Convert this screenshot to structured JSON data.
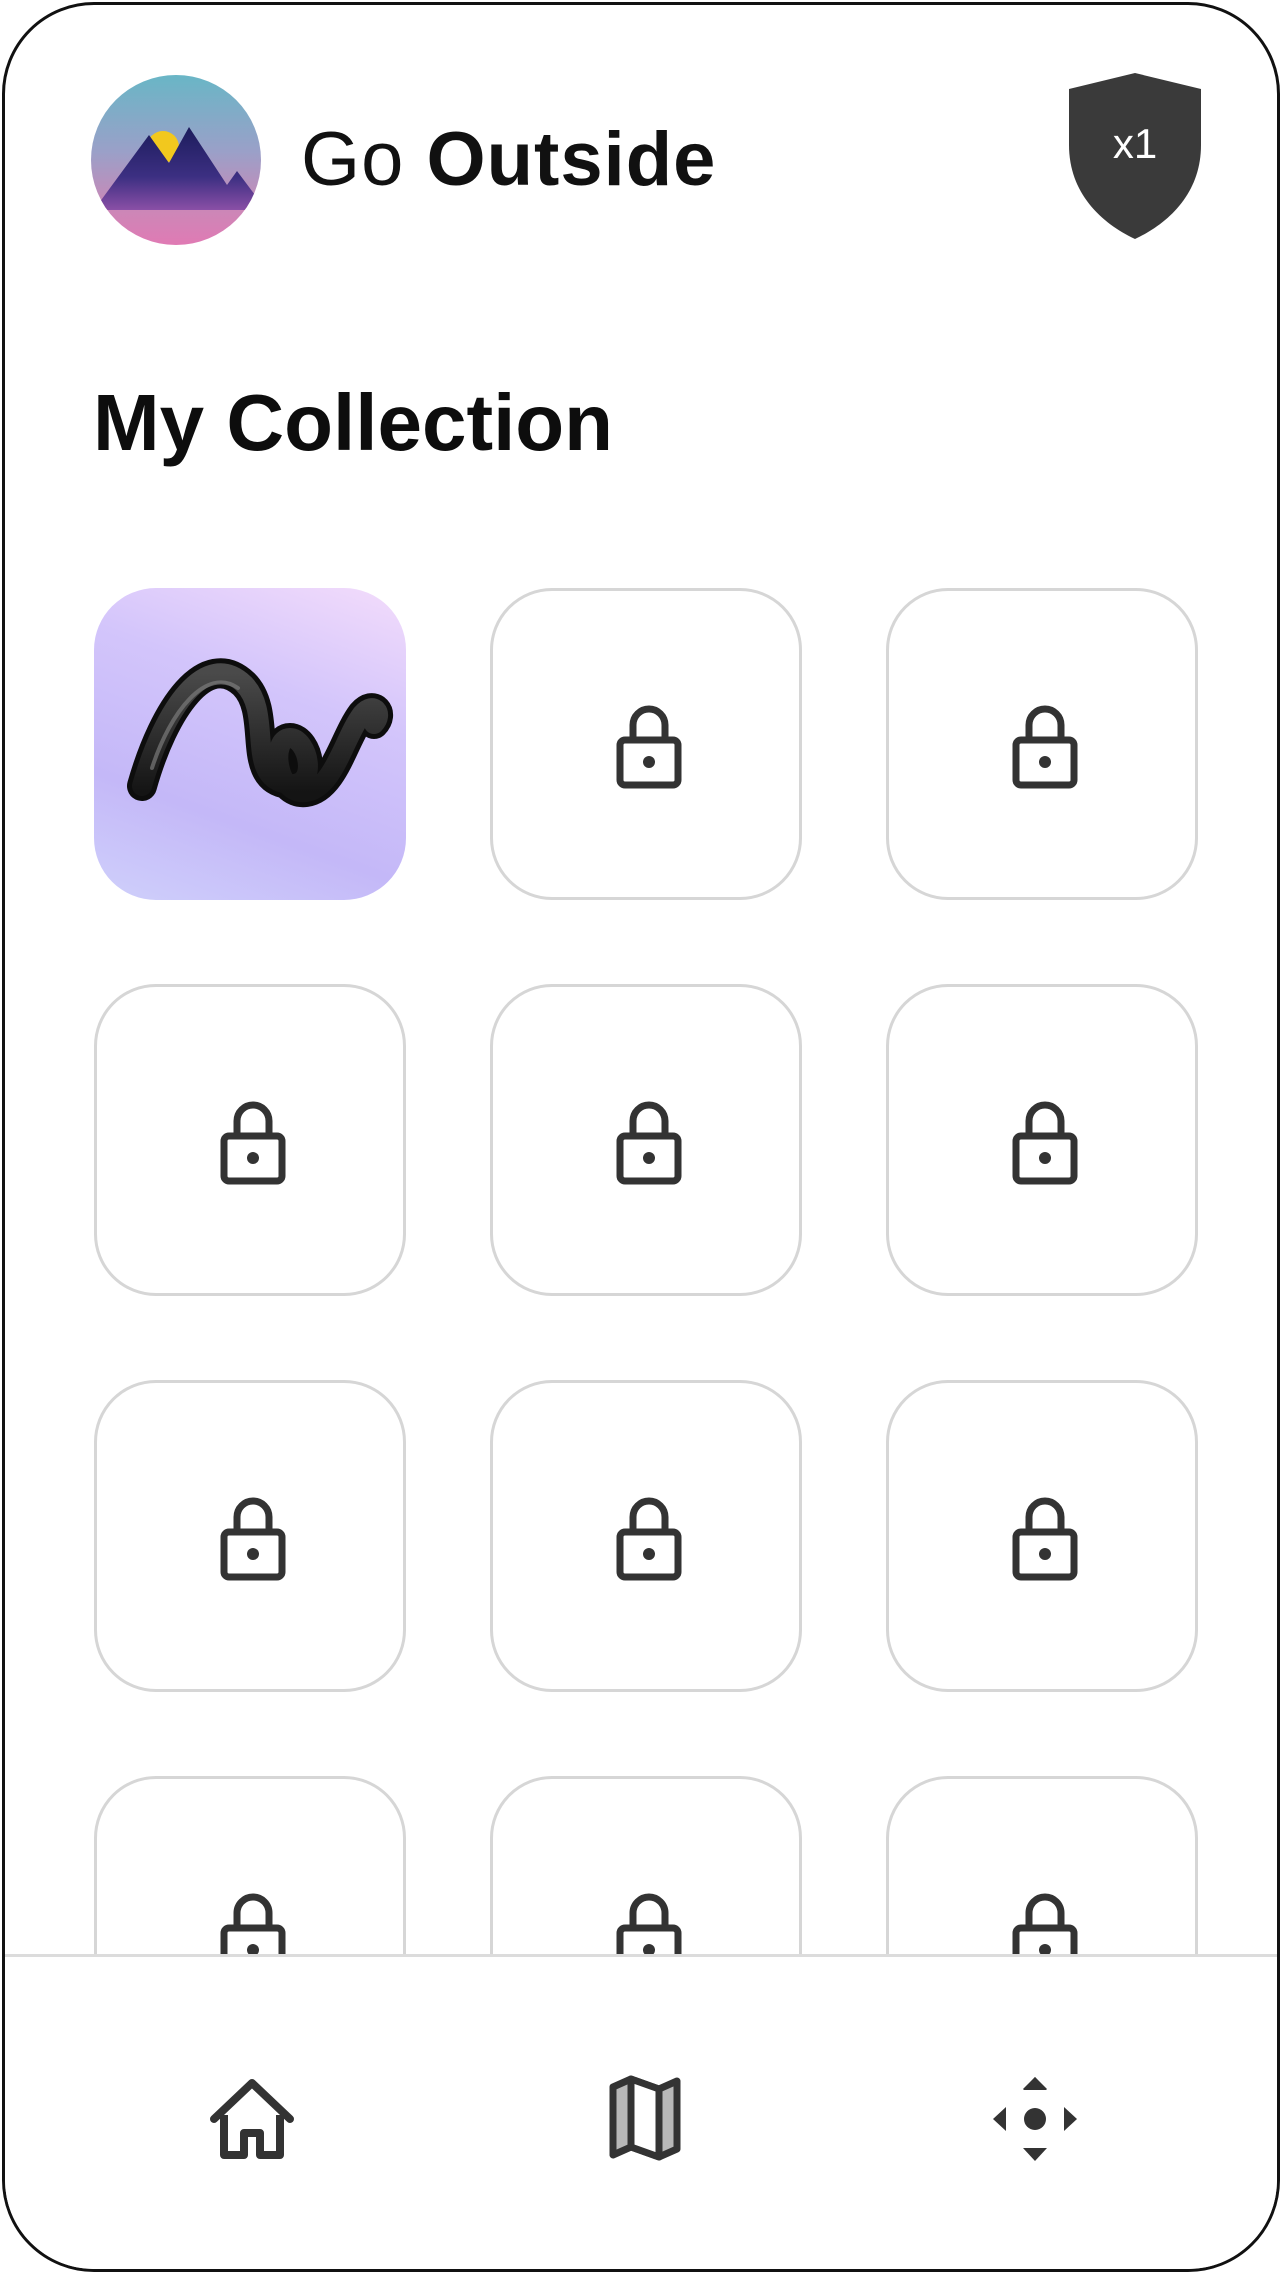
{
  "app": {
    "title_light": "Go",
    "title_bold": "Outside",
    "logo_icon": "mountain-sunset-logo"
  },
  "badge": {
    "label": "x1",
    "icon": "shield-icon",
    "color": "#3a3a3a"
  },
  "collection": {
    "title": "My Collection",
    "items": [
      {
        "state": "unlocked",
        "icon": "squiggle-artwork"
      },
      {
        "state": "locked",
        "icon": "lock-icon"
      },
      {
        "state": "locked",
        "icon": "lock-icon"
      },
      {
        "state": "locked",
        "icon": "lock-icon"
      },
      {
        "state": "locked",
        "icon": "lock-icon"
      },
      {
        "state": "locked",
        "icon": "lock-icon"
      },
      {
        "state": "locked",
        "icon": "lock-icon"
      },
      {
        "state": "locked",
        "icon": "lock-icon"
      },
      {
        "state": "locked",
        "icon": "lock-icon"
      },
      {
        "state": "locked",
        "icon": "lock-icon"
      },
      {
        "state": "locked",
        "icon": "lock-icon"
      },
      {
        "state": "locked",
        "icon": "lock-icon"
      }
    ]
  },
  "bottom_nav": {
    "items": [
      {
        "icon": "home-icon"
      },
      {
        "icon": "map-icon"
      },
      {
        "icon": "navigate-icon"
      }
    ]
  },
  "colors": {
    "icon_dark": "#333333",
    "tile_border": "#d6d6d6",
    "unlocked_tile": "#c4b8f8"
  }
}
